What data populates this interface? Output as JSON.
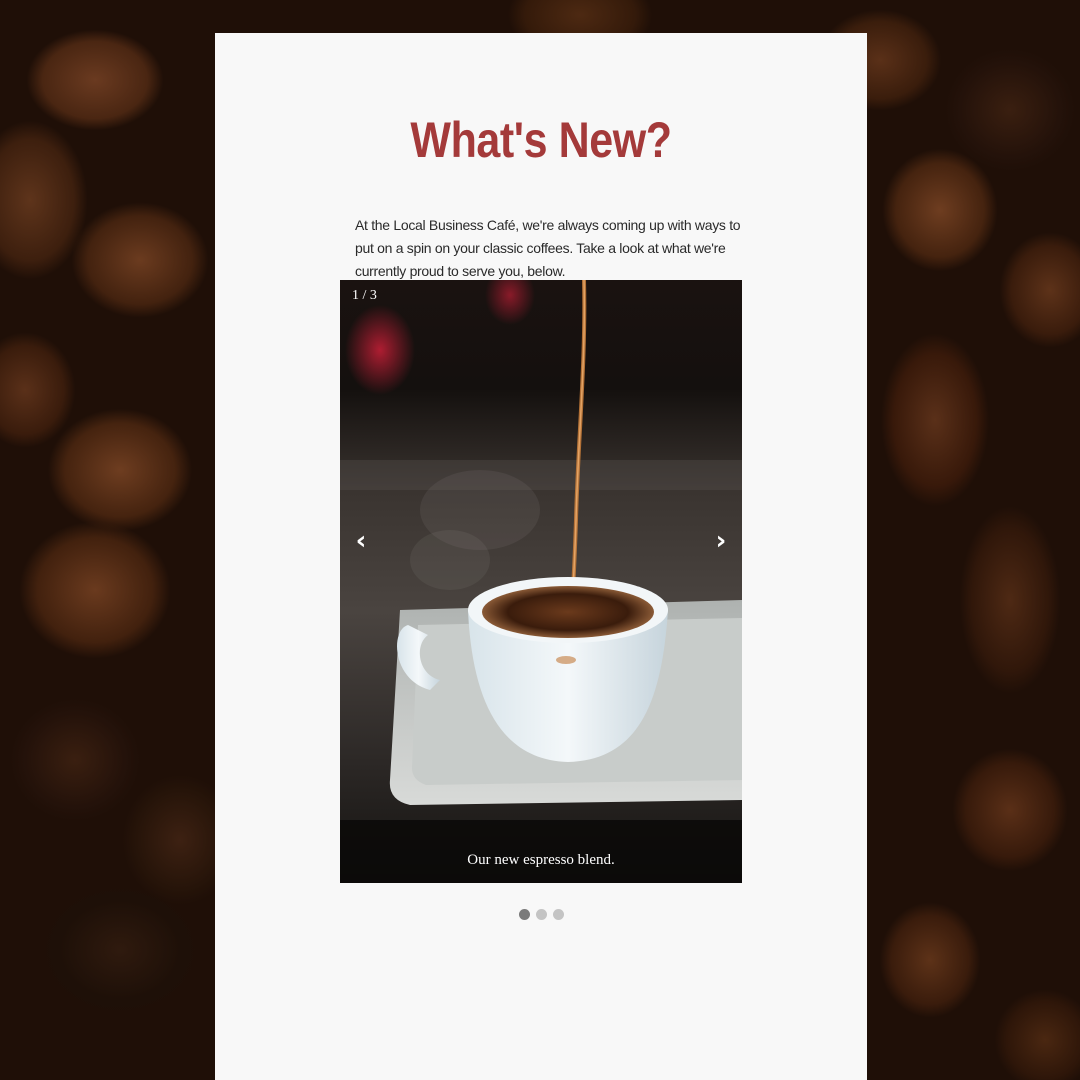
{
  "page": {
    "title": "What's New?",
    "intro": "At the Local Business Café, we're always coming up with ways to put on a spin on your classic coffees. Take a look at what we're currently proud to serve you, below."
  },
  "slideshow": {
    "counter": "1 / 3",
    "current_index": 1,
    "total": 3,
    "prev_icon": "‹",
    "next_icon": "›",
    "caption": "Our new espresso blend.",
    "image_subject": "coffee being poured into a white espresso cup on a metal tray"
  },
  "colors": {
    "title": "#a43a3a",
    "card_background": "#f8f8f8",
    "dot_active": "#7a7a7a",
    "dot_inactive": "#c4c4c4"
  }
}
